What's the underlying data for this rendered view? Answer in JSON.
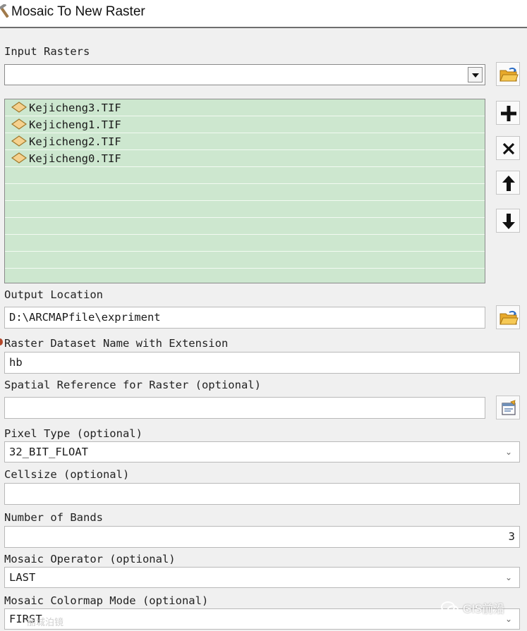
{
  "window": {
    "title": "Mosaic To New Raster"
  },
  "input_rasters": {
    "label": "Input Rasters",
    "combo_value": "",
    "items": [
      "Kejicheng3.TIF",
      "Kejicheng1.TIF",
      "Kejicheng2.TIF",
      "Kejicheng0.TIF"
    ]
  },
  "output_location": {
    "label": "Output Location",
    "value": "D:\\ARCMAPfile\\expriment"
  },
  "dataset_name": {
    "label": "Raster Dataset Name with Extension",
    "value": "hb"
  },
  "spatial_reference": {
    "label": "Spatial Reference for Raster (optional)",
    "value": ""
  },
  "pixel_type": {
    "label": "Pixel Type (optional)",
    "value": "32_BIT_FLOAT"
  },
  "cellsize": {
    "label": "Cellsize (optional)",
    "value": ""
  },
  "num_bands": {
    "label": "Number of Bands",
    "value": "3"
  },
  "mosaic_operator": {
    "label": "Mosaic Operator (optional)",
    "value": "LAST"
  },
  "colormap_mode": {
    "label": "Mosaic Colormap Mode (optional)",
    "value": "FIRST"
  },
  "watermark": {
    "brand": "GIS前沿",
    "faint": "丽城泊镜"
  },
  "colors": {
    "list_bg": "#cde7cf",
    "window_bg": "#f0f0f0",
    "folder": "#f2b431"
  },
  "icons": [
    "hammer-icon",
    "open-folder-icon",
    "add-icon",
    "remove-icon",
    "move-up-icon",
    "move-down-icon",
    "spatial-reference-icon",
    "raster-dataset-icon",
    "chevron-down-icon",
    "wechat-icon"
  ]
}
